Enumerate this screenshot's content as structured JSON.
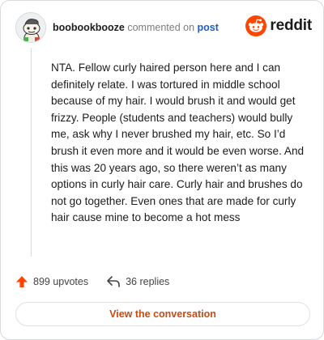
{
  "header": {
    "username": "boobookbooze",
    "action_text": "commented on",
    "post_link": "post",
    "brand": "reddit"
  },
  "comment": {
    "body": "NTA. Fellow curly haired person here and I can definitely relate. I was tortured in middle school because of my hair. I would brush it and would get frizzy. People (students and teachers) would bully me, ask why I never brushed my hair, etc. So I’d brush it even more and it would be even worse. And this was 20 years ago, so there weren’t as many options in curly hair care. Curly hair and brushes do not go together. Even ones that are made for curly hair cause mine to become a hot mess"
  },
  "stats": {
    "upvotes": "899 upvotes",
    "replies": "36 replies"
  },
  "cta": {
    "label": "View the conversation"
  },
  "colors": {
    "reddit_orange": "#ff4500",
    "link_blue": "#1c5fbf",
    "cta_text": "#c84a14"
  },
  "icons": {
    "avatar": "snoo-avatar",
    "logo": "reddit-snoo-icon",
    "upvote": "upvote-arrow-icon",
    "reply": "reply-arrow-icon"
  }
}
